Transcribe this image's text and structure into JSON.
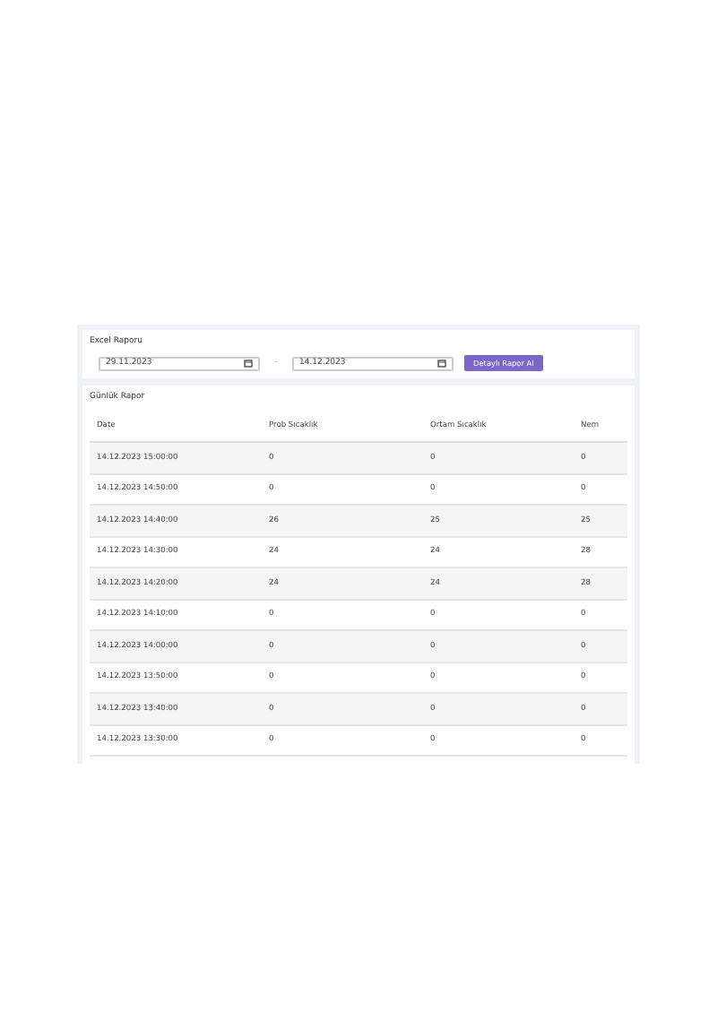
{
  "excel_report": {
    "title": "Excel Raporu",
    "start_date": "29.11.2023",
    "separator": "-",
    "end_date": "14.12.2023",
    "button": "Detaylı Rapor Al"
  },
  "daily_report": {
    "title": "Günlük Rapor",
    "columns": [
      "Date",
      "Prob Sıcaklık",
      "Ortam Sıcaklık",
      "Nem"
    ],
    "rows": [
      [
        "14.12.2023 15:00:00",
        "0",
        "0",
        "0"
      ],
      [
        "14.12.2023 14:50:00",
        "0",
        "0",
        "0"
      ],
      [
        "14.12.2023 14:40:00",
        "26",
        "25",
        "25"
      ],
      [
        "14.12.2023 14:30:00",
        "24",
        "24",
        "28"
      ],
      [
        "14.12.2023 14:20:00",
        "24",
        "24",
        "28"
      ],
      [
        "14.12.2023 14:10:00",
        "0",
        "0",
        "0"
      ],
      [
        "14.12.2023 14:00:00",
        "0",
        "0",
        "0"
      ],
      [
        "14.12.2023 13:50:00",
        "0",
        "0",
        "0"
      ],
      [
        "14.12.2023 13:40:00",
        "0",
        "0",
        "0"
      ],
      [
        "14.12.2023 13:30:00",
        "0",
        "0",
        "0"
      ]
    ]
  }
}
